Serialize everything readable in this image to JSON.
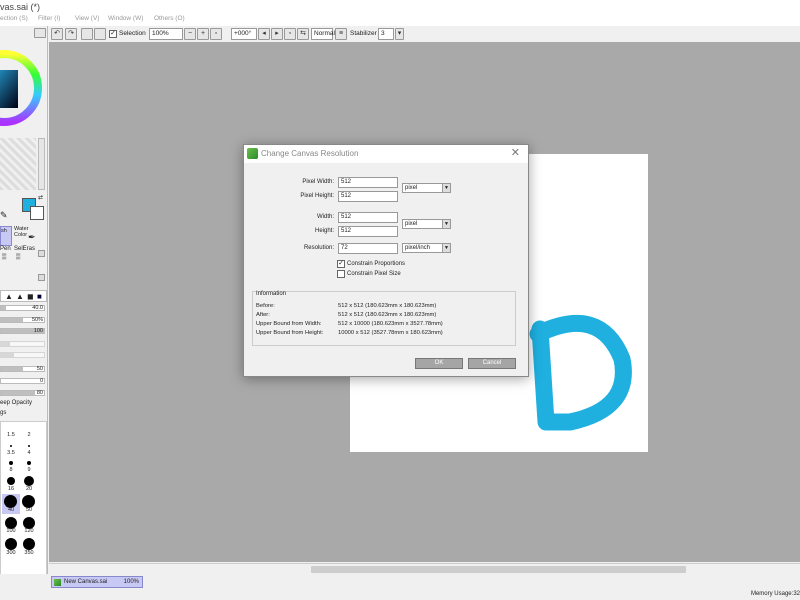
{
  "window": {
    "title": "vas.sai (*)"
  },
  "menu": [
    "ection (S)",
    "Filter (I)",
    "View (V)",
    "Window (W)",
    "Others (O)"
  ],
  "toolbar": {
    "selection_label": "Selection",
    "zoom_value": "100%",
    "rotation_value": "+000°",
    "blend_mode": "Normal",
    "stabilizer_label": "Stabilizer",
    "stabilizer_value": "3"
  },
  "left_panel": {
    "tool_labels": [
      "sh",
      "Water Color",
      "Pen",
      "SelEras"
    ],
    "sliders": [
      {
        "value": "40.0",
        "fill": 0.12
      },
      {
        "value": "50%",
        "fill": 0.5
      },
      {
        "value": "100",
        "fill": 1.0
      },
      {
        "value": "",
        "fill": 0.2
      },
      {
        "value": "",
        "fill": 0.3
      },
      {
        "value": "50",
        "fill": 0.5
      },
      {
        "value": "0",
        "fill": 0.0
      },
      {
        "value": "80",
        "fill": 0.8
      }
    ],
    "keep_opacity": "eep Opacity",
    "gs_label": "gs",
    "brush_sizes": [
      "1.5",
      "2",
      "3.5",
      "4",
      "8",
      "9",
      "16",
      "20",
      "40",
      "50",
      "100",
      "120",
      "300",
      "350"
    ]
  },
  "canvas": {
    "letter": "D",
    "letter_color": "#1fb0e0"
  },
  "tabs": [
    {
      "label": "New Canvas.sai",
      "zoom": "100%"
    }
  ],
  "status": {
    "memory": "Memory Usage:32"
  },
  "dialog": {
    "title": "Change Canvas Resolution",
    "close": "✕",
    "fields": {
      "pixel_width_label": "Pixel Width:",
      "pixel_width": "512",
      "pixel_height_label": "Pixel Height:",
      "pixel_height": "512",
      "pixel_unit": "pixel",
      "width_label": "Width:",
      "width": "512",
      "height_label": "Height:",
      "height": "512",
      "size_unit": "pixel",
      "resolution_label": "Resolution:",
      "resolution": "72",
      "resolution_unit": "pixel/inch"
    },
    "constrain_proportions": "Constrain Proportions",
    "constrain_pixel_size": "Constrain Pixel Size",
    "info": {
      "heading": "Information",
      "rows": [
        {
          "label": "Before:",
          "value": "512 x 512 (180.623mm x 180.623mm)"
        },
        {
          "label": "After:",
          "value": "512 x 512 (180.623mm x 180.623mm)"
        },
        {
          "label": "Upper Bound from Width:",
          "value": "512 x 10000 (180.623mm x 3527.78mm)"
        },
        {
          "label": "Upper Bound from Height:",
          "value": "10000 x 512 (3527.78mm x 180.623mm)"
        }
      ]
    },
    "ok": "OK",
    "cancel": "Cancel"
  }
}
